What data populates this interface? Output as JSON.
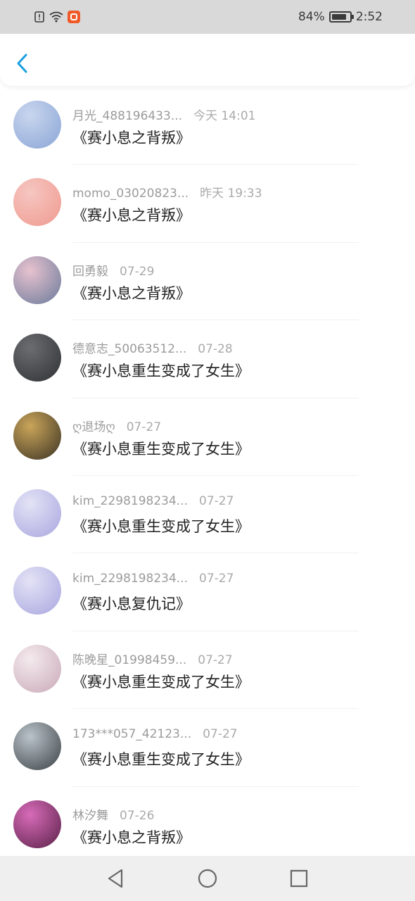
{
  "status_bar": {
    "battery_text": "84%",
    "battery_level": 0.84,
    "time": "2:52"
  },
  "header": {
    "back_icon": "chevron-left-icon",
    "accent_color": "#1a9fe0"
  },
  "items": [
    {
      "name": "月光_488196433...",
      "time": "今天 14:01",
      "title": "《赛小息之背叛》",
      "avatar_colors": [
        "#c9d6ee",
        "#8aa5d6"
      ]
    },
    {
      "name": "momo_03020823...",
      "time": "昨天 19:33",
      "title": "《赛小息之背叛》",
      "avatar_colors": [
        "#f6c6c1",
        "#ef9a8f"
      ]
    },
    {
      "name": "回勇毅",
      "time": "07-29",
      "title": "《赛小息之背叛》",
      "avatar_colors": [
        "#e7c2cf",
        "#6a7a9a"
      ]
    },
    {
      "name": "德意志_50063512...",
      "time": "07-28",
      "title": "《赛小息重生变成了女生》",
      "avatar_colors": [
        "#6b6d70",
        "#2f3134"
      ]
    },
    {
      "name": "ღ退场ღ",
      "time": "07-27",
      "title": "《赛小息重生变成了女生》",
      "avatar_colors": [
        "#caa55a",
        "#3b3324"
      ]
    },
    {
      "name": "kim_2298198234...",
      "time": "07-27",
      "title": "《赛小息重生变成了女生》",
      "avatar_colors": [
        "#e3e3f6",
        "#a9a6df"
      ]
    },
    {
      "name": "kim_2298198234...",
      "time": "07-27",
      "title": "《赛小息复仇记》",
      "avatar_colors": [
        "#e3e3f6",
        "#a9a6df"
      ]
    },
    {
      "name": "陈晚星_01998459...",
      "time": "07-27",
      "title": "《赛小息重生变成了女生》",
      "avatar_colors": [
        "#f4eaee",
        "#c9a9b6"
      ]
    },
    {
      "name": "173***057_42123...",
      "time": "07-27",
      "title": "《赛小息重生变成了女生》",
      "avatar_colors": [
        "#b9c3c9",
        "#3c4246"
      ]
    },
    {
      "name": "林汐舞",
      "time": "07-26",
      "title": "《赛小息之背叛》",
      "avatar_colors": [
        "#d76bb8",
        "#5a2148"
      ]
    }
  ],
  "nav": {
    "back": "back-triangle-icon",
    "home": "home-circle-icon",
    "recent": "recent-square-icon"
  }
}
